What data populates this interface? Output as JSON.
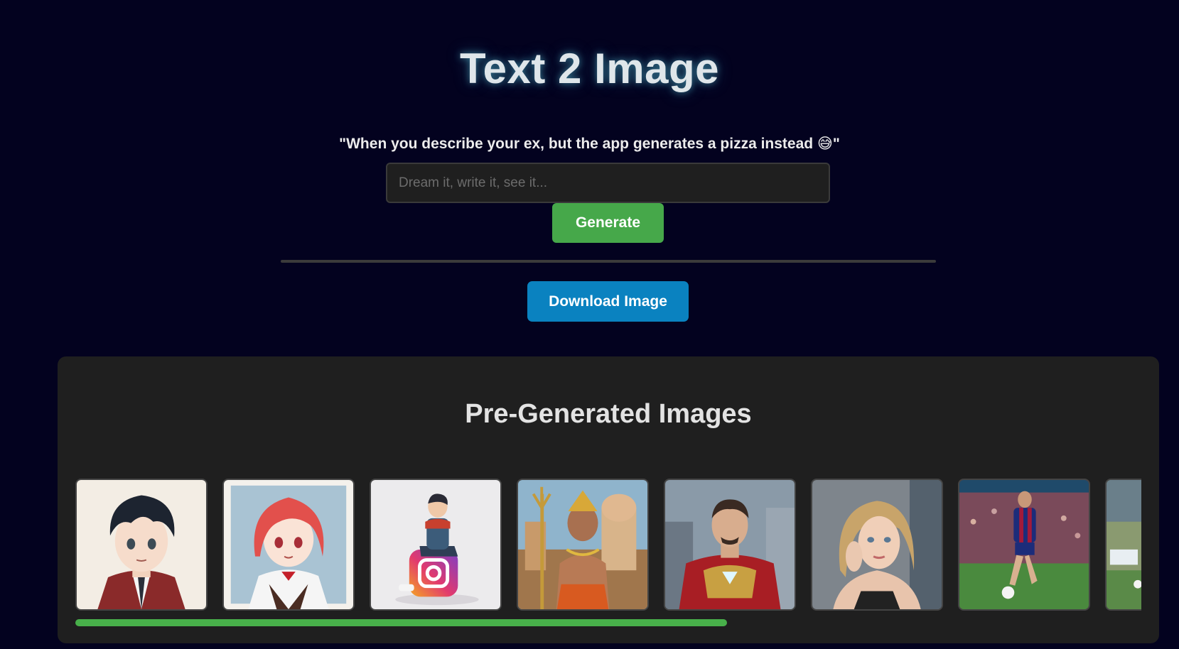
{
  "header": {
    "title": "Text 2 Image",
    "tagline_open": "\"When you describe your ex, but the app generates a pizza instead",
    "tagline_emoji": "😅",
    "tagline_close": "\""
  },
  "prompt": {
    "placeholder": "Dream it, write it, see it...",
    "value": ""
  },
  "buttons": {
    "generate_label": "Generate",
    "download_label": "Download Image"
  },
  "gallery": {
    "title": "Pre-Generated Images",
    "images": [
      {
        "subject": "anime-boy-portrait"
      },
      {
        "subject": "anime-girl-portrait"
      },
      {
        "subject": "cartoon-boy-on-instagram-logo"
      },
      {
        "subject": "hindu-deity-with-trident"
      },
      {
        "subject": "iron-man"
      },
      {
        "subject": "blonde-woman-portrait"
      },
      {
        "subject": "football-player"
      },
      {
        "subject": "football-action-partial"
      }
    ]
  },
  "colors": {
    "background": "#03021f",
    "generate": "#46a84a",
    "download": "#0a82c0",
    "panel": "#1f1f1f",
    "scrollbar": "#48b04a"
  }
}
